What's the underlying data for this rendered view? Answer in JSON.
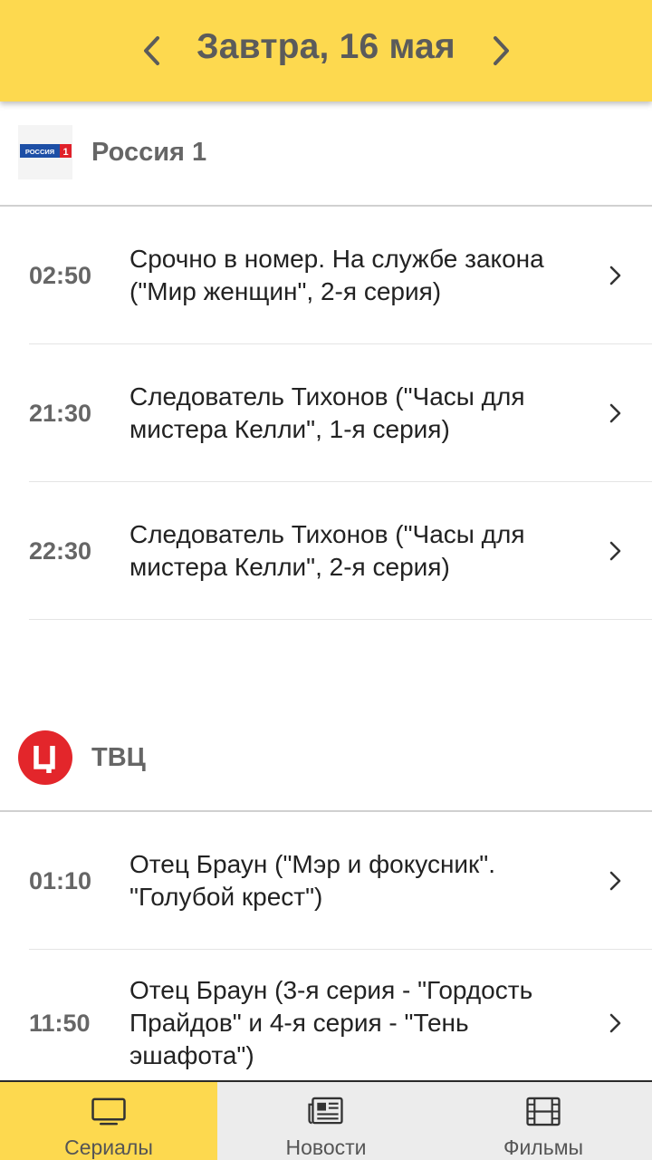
{
  "header": {
    "title": "Завтра, 16 мая",
    "prev_icon": "chevron-left-icon",
    "next_icon": "chevron-right-icon"
  },
  "channels": [
    {
      "name": "Россия 1",
      "logo_text": "РОССИЯ",
      "logo_num": "1",
      "programs": [
        {
          "time": "02:50",
          "title": "Срочно в номер. На службе закона (\"Мир женщин\", 2-я серия)"
        },
        {
          "time": "21:30",
          "title": "Следователь Тихонов (\"Часы для мистера Келли\", 1-я серия)"
        },
        {
          "time": "22:30",
          "title": "Следователь Тихонов (\"Часы для мистера Келли\", 2-я серия)"
        }
      ]
    },
    {
      "name": "ТВЦ",
      "logo_color": "#e3262b",
      "programs": [
        {
          "time": "01:10",
          "title": "Отец Браун (\"Мэр и фокусник\". \"Голубой крест\")"
        },
        {
          "time": "11:50",
          "title": "Отец Браун (3-я серия - \"Гордость Прайдов\" и 4-я серия - \"Тень эшафота\")"
        }
      ]
    }
  ],
  "tabs": [
    {
      "label": "Сериалы",
      "icon": "tv-icon",
      "active": true
    },
    {
      "label": "Новости",
      "icon": "newspaper-icon",
      "active": false
    },
    {
      "label": "Фильмы",
      "icon": "film-icon",
      "active": false
    }
  ],
  "colors": {
    "accent": "#fdd94f",
    "text_primary": "#222222",
    "text_secondary": "#666666"
  }
}
